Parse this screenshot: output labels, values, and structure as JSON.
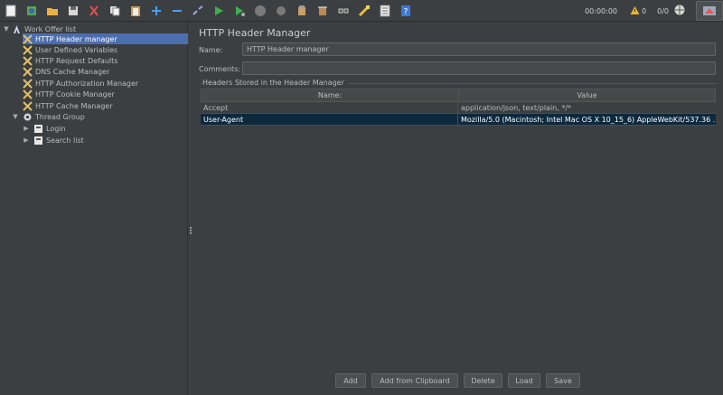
{
  "toolbar": {
    "icons": [
      "new-icon",
      "templates-icon",
      "open-icon",
      "save-icon",
      "cut-icon",
      "copy-icon",
      "paste-icon",
      "expand-icon",
      "collapse-icon",
      "toggle-icon",
      "start-icon",
      "start-no-pause-icon",
      "stop-icon",
      "shutdown-icon",
      "clear-icon",
      "clear-all-icon",
      "search-icon",
      "reset-search-icon",
      "function-helper-icon",
      "help-icon"
    ],
    "timer": "00:00:00",
    "warning_count": "0",
    "threads": "0/0"
  },
  "tree": {
    "items": [
      {
        "label": "Work Offer list",
        "icon": "test-plan-icon"
      },
      {
        "label": "HTTP Header manager",
        "icon": "config-icon"
      },
      {
        "label": "User Defined Variables",
        "icon": "config-icon"
      },
      {
        "label": "HTTP Request Defaults",
        "icon": "config-icon"
      },
      {
        "label": "DNS Cache Manager",
        "icon": "config-icon"
      },
      {
        "label": "HTTP Authorization Manager",
        "icon": "config-icon"
      },
      {
        "label": "HTTP Cookie Manager",
        "icon": "config-icon"
      },
      {
        "label": "HTTP Cache Manager",
        "icon": "config-icon"
      },
      {
        "label": "Thread Group",
        "icon": "gear-icon"
      },
      {
        "label": "Login",
        "icon": "controller-icon"
      },
      {
        "label": "Search list",
        "icon": "controller-icon"
      }
    ]
  },
  "main": {
    "title": "HTTP Header Manager",
    "name_label": "Name:",
    "name_value": "HTTP Header manager",
    "comments_label": "Comments:",
    "comments_value": "",
    "group_title": "Headers Stored in the Header Manager",
    "columns": [
      "Name:",
      "Value"
    ],
    "rows": [
      {
        "name": "Accept",
        "value": "application/json, text/plain, */*"
      },
      {
        "name": "User-Agent",
        "value": "Mozilla/5.0 (Macintosh; Intel Mac OS X 10_15_6) AppleWebKit/537.36 ..."
      }
    ],
    "buttons": {
      "add": "Add",
      "add_clipboard": "Add from Clipboard",
      "delete": "Delete",
      "load": "Load",
      "save": "Save"
    }
  },
  "colors": {
    "background": "#3c3f41",
    "selection": "#4b6eaf",
    "table_selection": "#0d293e"
  }
}
